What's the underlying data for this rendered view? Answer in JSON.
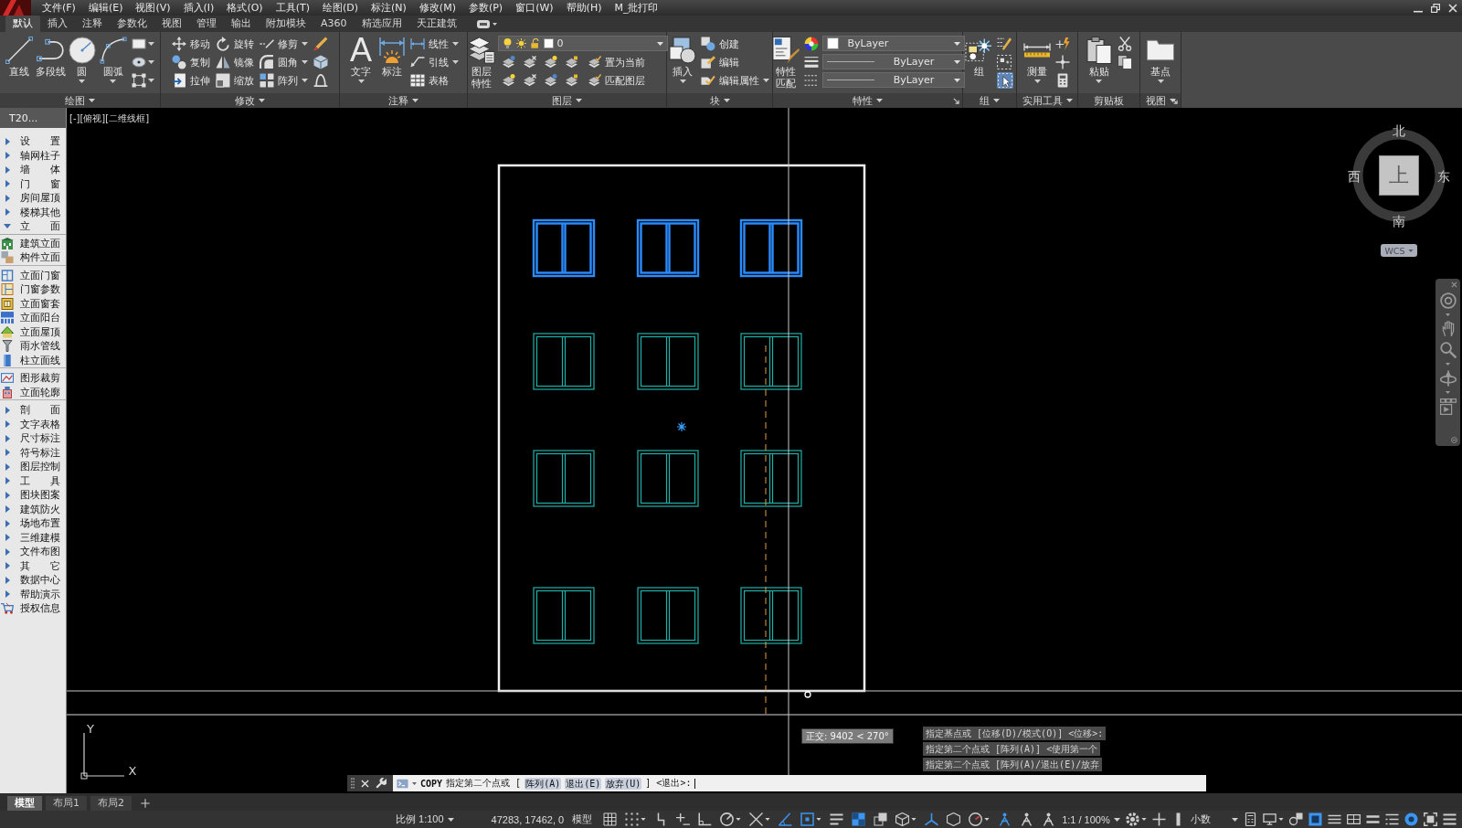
{
  "menu_bar": {
    "items": [
      "文件(F)",
      "编辑(E)",
      "视图(V)",
      "插入(I)",
      "格式(O)",
      "工具(T)",
      "绘图(D)",
      "标注(N)",
      "修改(M)",
      "参数(P)",
      "窗口(W)",
      "帮助(H)",
      "M_批打印"
    ]
  },
  "ribbon_tabs": [
    {
      "label": "默认",
      "selected": true
    },
    {
      "label": "插入",
      "selected": false
    },
    {
      "label": "注释",
      "selected": false
    },
    {
      "label": "参数化",
      "selected": false
    },
    {
      "label": "视图",
      "selected": false
    },
    {
      "label": "管理",
      "selected": false
    },
    {
      "label": "输出",
      "selected": false
    },
    {
      "label": "附加模块",
      "selected": false
    },
    {
      "label": "A360",
      "selected": false
    },
    {
      "label": "精选应用",
      "selected": false
    },
    {
      "label": "天正建筑",
      "selected": false
    }
  ],
  "ribbon_panels": [
    {
      "title": "绘图",
      "expandable": true,
      "dialog_launcher": false,
      "tools": [
        {
          "label": "直线"
        },
        {
          "label": "多段线"
        },
        {
          "label": "圆"
        },
        {
          "label": "圆弧"
        }
      ]
    },
    {
      "title": "修改",
      "expandable": true,
      "dialog_launcher": false,
      "tools": [
        {
          "label": "移动"
        },
        {
          "label": "复制"
        },
        {
          "label": "拉伸"
        },
        {
          "label": "旋转"
        },
        {
          "label": "镜像"
        },
        {
          "label": "缩放"
        },
        {
          "label": "修剪"
        },
        {
          "label": "圆角"
        },
        {
          "label": "阵列"
        }
      ]
    },
    {
      "title": "注释",
      "expandable": true,
      "dialog_launcher": false,
      "tools": [
        {
          "label": "文字",
          "glyph": "A"
        },
        {
          "label": "标注"
        },
        {
          "label": "线性"
        },
        {
          "label": "引线"
        },
        {
          "label": "表格"
        }
      ]
    },
    {
      "title": "图层",
      "expandable": true,
      "dialog_launcher": false,
      "tools": [
        {
          "label": "图层特性"
        },
        {
          "label": "置为当前"
        },
        {
          "label": "匹配图层"
        }
      ],
      "layer": {
        "value": "0"
      }
    },
    {
      "title": "块",
      "expandable": true,
      "dialog_launcher": false,
      "tools": [
        {
          "label": "插入"
        },
        {
          "label": "创建"
        },
        {
          "label": "编辑"
        },
        {
          "label": "编辑属性"
        }
      ]
    },
    {
      "title": "特性",
      "expandable": true,
      "dialog_launcher": true,
      "tools": [
        {
          "label": "特性匹配"
        }
      ],
      "dropdowns": [
        {
          "value": "ByLayer"
        },
        {
          "value": "ByLayer"
        },
        {
          "value": "ByLayer"
        }
      ]
    },
    {
      "title": "组",
      "expandable": true,
      "dialog_launcher": false,
      "tools": [
        {
          "label": "组"
        }
      ],
      "toggles": [
        {
          "on": true
        }
      ]
    },
    {
      "title": "实用工具",
      "expandable": true,
      "dialog_launcher": false,
      "tools": [
        {
          "label": "测量"
        }
      ]
    },
    {
      "title": "剪贴板",
      "expandable": false,
      "dialog_launcher": false,
      "tools": [
        {
          "label": "粘贴"
        }
      ]
    },
    {
      "title": "视图",
      "expandable": true,
      "dialog_launcher": true,
      "tools": [
        {
          "label": "基点"
        }
      ]
    }
  ],
  "tool_palette": {
    "title": "T20...",
    "items": [
      {
        "label": "设　　置",
        "kind": "category",
        "expanded": false
      },
      {
        "label": "轴网柱子",
        "kind": "category",
        "expanded": false
      },
      {
        "label": "墙　　体",
        "kind": "category",
        "expanded": false
      },
      {
        "label": "门　　窗",
        "kind": "category",
        "expanded": false
      },
      {
        "label": "房间屋顶",
        "kind": "category",
        "expanded": false
      },
      {
        "label": "楼梯其他",
        "kind": "category",
        "expanded": false
      },
      {
        "label": "立　　面",
        "kind": "category",
        "expanded": true,
        "children": [
          {
            "label": "建筑立面",
            "divider_after": false
          },
          {
            "label": "构件立面",
            "divider_after": true
          },
          {
            "label": "立面门窗",
            "divider_after": false
          },
          {
            "label": "门窗参数",
            "divider_after": false
          },
          {
            "label": "立面窗套",
            "divider_after": false
          },
          {
            "label": "立面阳台",
            "divider_after": false
          },
          {
            "label": "立面屋顶",
            "divider_after": false
          },
          {
            "label": "雨水管线",
            "divider_after": false
          },
          {
            "label": "柱立面线",
            "divider_after": true
          },
          {
            "label": "图形裁剪",
            "divider_after": false
          },
          {
            "label": "立面轮廓",
            "divider_after": true
          }
        ]
      },
      {
        "label": "剖　　面",
        "kind": "category",
        "expanded": false
      },
      {
        "label": "文字表格",
        "kind": "category",
        "expanded": false
      },
      {
        "label": "尺寸标注",
        "kind": "category",
        "expanded": false
      },
      {
        "label": "符号标注",
        "kind": "category",
        "expanded": false
      },
      {
        "label": "图层控制",
        "kind": "category",
        "expanded": false
      },
      {
        "label": "工　　具",
        "kind": "category",
        "expanded": false
      },
      {
        "label": "图块图案",
        "kind": "category",
        "expanded": false
      },
      {
        "label": "建筑防火",
        "kind": "category",
        "expanded": false
      },
      {
        "label": "场地布置",
        "kind": "category",
        "expanded": false
      },
      {
        "label": "三维建模",
        "kind": "category",
        "expanded": false
      },
      {
        "label": "文件布图",
        "kind": "category",
        "expanded": false
      },
      {
        "label": "其　　它",
        "kind": "category",
        "expanded": false
      },
      {
        "label": "数据中心",
        "kind": "category",
        "expanded": false
      },
      {
        "label": "帮助演示",
        "kind": "category",
        "expanded": false
      },
      {
        "label": "授权信息",
        "kind": "command"
      }
    ]
  },
  "viewport": {
    "controls": [
      "[-]",
      "[俯视]",
      "[二维线框]"
    ],
    "drawing": {
      "window_rows": [
        {
          "windows": [
            {
              "selected": true
            },
            {
              "selected": true
            },
            {
              "selected": true
            }
          ]
        },
        {
          "windows": [
            {
              "selected": false
            },
            {
              "selected": false
            },
            {
              "selected": false
            }
          ]
        },
        {
          "windows": [
            {
              "selected": false
            },
            {
              "selected": false
            },
            {
              "selected": false
            }
          ]
        },
        {
          "windows": [
            {
              "selected": false
            },
            {
              "selected": false
            },
            {
              "selected": false
            }
          ]
        }
      ]
    },
    "view_cube": {
      "north": "北",
      "west": "西",
      "face": "上",
      "east": "东",
      "south": "南",
      "coordinate_system": "WCS"
    },
    "ucs": {
      "y_label": "Y",
      "x_label": "X"
    },
    "tooltip": "正交: 9402 < 270°",
    "command_history": [
      "指定基点或 [位移(D)/模式(O)] <位移>:",
      "指定第二个点或 [阵列(A)] <使用第一个",
      "指定第二个点或 [阵列(A)/退出(E)/放弃"
    ],
    "command_line": {
      "command": "COPY",
      "prompt": "指定第二个点或 [",
      "options": [
        "阵列(A)",
        "退出(E)",
        "放弃(U)"
      ],
      "suffix": "] <退出>:"
    }
  },
  "layout_tabs": [
    {
      "label": "模型",
      "selected": true
    },
    {
      "label": "布局1",
      "selected": false
    },
    {
      "label": "布局2",
      "selected": false
    }
  ],
  "status_bar": {
    "items": [
      {
        "kind": "dropdown",
        "label": "比例 1:100"
      },
      {
        "kind": "text",
        "label": "47283, 17462, 0"
      },
      {
        "kind": "button",
        "label": "模型"
      },
      {
        "kind": "toggle",
        "on": false
      },
      {
        "kind": "toggle",
        "on": false
      },
      {
        "kind": "toggle",
        "on": false
      },
      {
        "kind": "toggle",
        "on": false
      },
      {
        "kind": "toggle",
        "on": false
      },
      {
        "kind": "toggle",
        "on": false
      },
      {
        "kind": "toggle",
        "on": false
      },
      {
        "kind": "toggle",
        "on": true
      },
      {
        "kind": "toggle",
        "on": true
      },
      {
        "kind": "toggle",
        "on": false
      },
      {
        "kind": "toggle",
        "on": true
      },
      {
        "kind": "toggle",
        "on": false
      },
      {
        "kind": "toggle",
        "on": false
      },
      {
        "kind": "toggle",
        "on": true
      },
      {
        "kind": "toggle",
        "on": false
      },
      {
        "kind": "toggle",
        "on": false
      },
      {
        "kind": "toggle",
        "on": true
      },
      {
        "kind": "toggle",
        "on": false
      },
      {
        "kind": "toggle",
        "on": false
      },
      {
        "kind": "dropdown",
        "label": "1:1 / 100%"
      },
      {
        "kind": "toggle",
        "on": false
      },
      {
        "kind": "toggle",
        "on": false
      },
      {
        "kind": "toggle",
        "on": false
      },
      {
        "kind": "dropdown",
        "label": "小数"
      },
      {
        "kind": "toggle",
        "on": false
      },
      {
        "kind": "toggle",
        "on": false
      },
      {
        "kind": "toggle",
        "on": false
      },
      {
        "kind": "toggle",
        "on": true
      },
      {
        "kind": "toggle",
        "on": false
      },
      {
        "kind": "toggle",
        "on": false
      },
      {
        "kind": "toggle",
        "on": false
      },
      {
        "kind": "toggle",
        "on": false
      },
      {
        "kind": "toggle",
        "on": true
      },
      {
        "kind": "toggle",
        "on": false
      },
      {
        "kind": "toggle",
        "on": false
      }
    ]
  }
}
